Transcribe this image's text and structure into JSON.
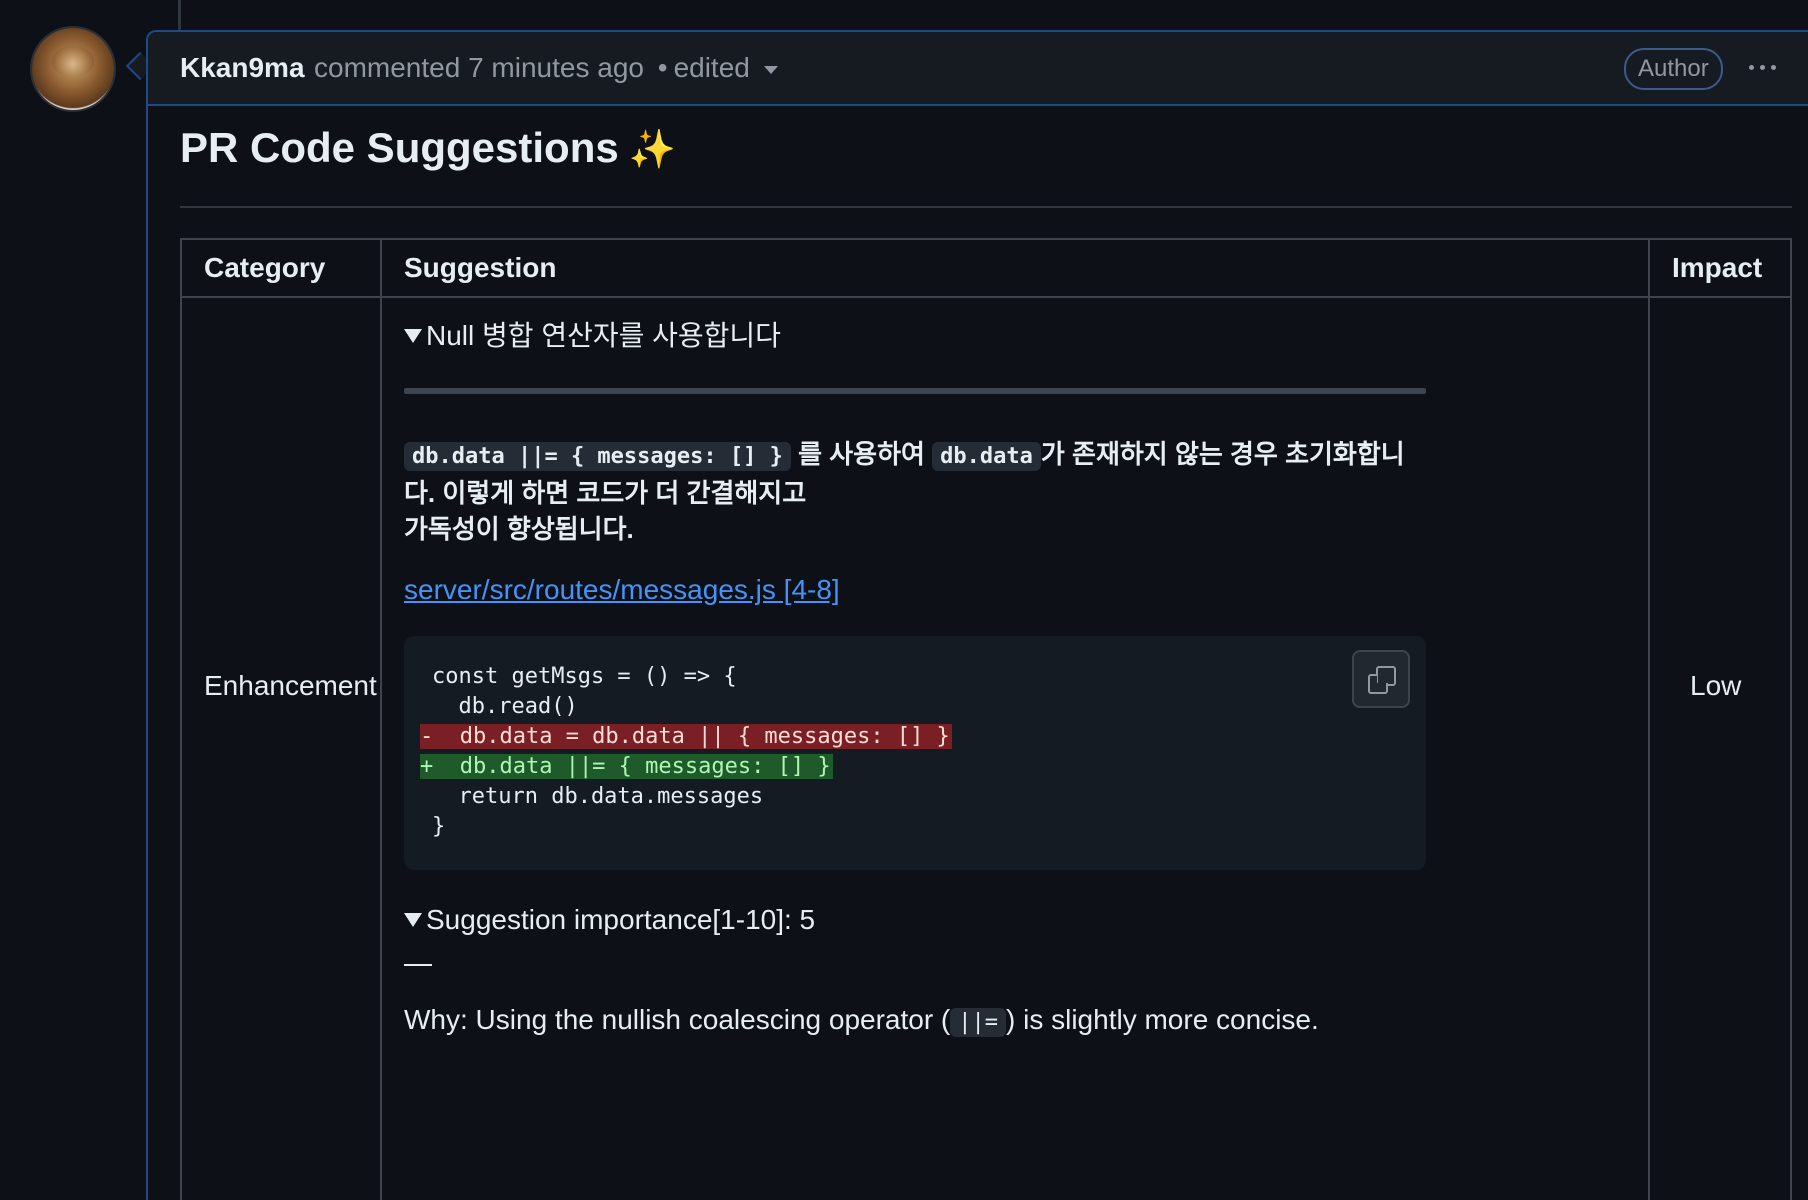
{
  "comment": {
    "author": "Kkan9ma",
    "action": "commented",
    "time": "7 minutes ago",
    "separator": "•",
    "edited": "edited",
    "badge": "Author",
    "menu_icon": "kebab-horizontal-icon"
  },
  "body": {
    "title": "PR Code Suggestions",
    "title_emoji": "✨",
    "table": {
      "headers": {
        "category": "Category",
        "suggestion": "Suggestion",
        "impact": "Impact"
      },
      "rows": [
        {
          "category": "Enhancement",
          "impact": "Low",
          "summary": "Null 병합 연산자를 사용합니다",
          "desc_code_1": "db.data ||= { messages: [] }",
          "desc_text_1": "를 사용하여",
          "desc_code_2": "db.data",
          "desc_text_2": "가 존재하지 않는 경우 초기화합니다. 이렇게 하면 코드가 더 간결해지고",
          "desc_text_3": "가독성이 향상됩니다.",
          "file_link": "server/src/routes/messages.js [4-8]",
          "code": {
            "line1": "const getMsgs = () => {",
            "line2": "  db.read()",
            "line3": "-  db.data = db.data || { messages: [] }",
            "line4": "+  db.data ||= { messages: [] }",
            "line5": "  return db.data.messages",
            "line6": "}"
          },
          "copy_icon": "copy-icon",
          "importance_summary": "Suggestion importance[1-10]: 5",
          "dash": "—",
          "why_prefix": "Why: Using the nullish coalescing operator (",
          "why_code": "||=",
          "why_suffix": ") is slightly more concise."
        }
      ]
    }
  },
  "colors": {
    "background": "#0d1117",
    "header_bg": "#161b22",
    "accent_border": "#1f4a8a",
    "link": "#4493f8",
    "diff_removed": "#7a1f23",
    "diff_added": "#1f5a2a"
  }
}
